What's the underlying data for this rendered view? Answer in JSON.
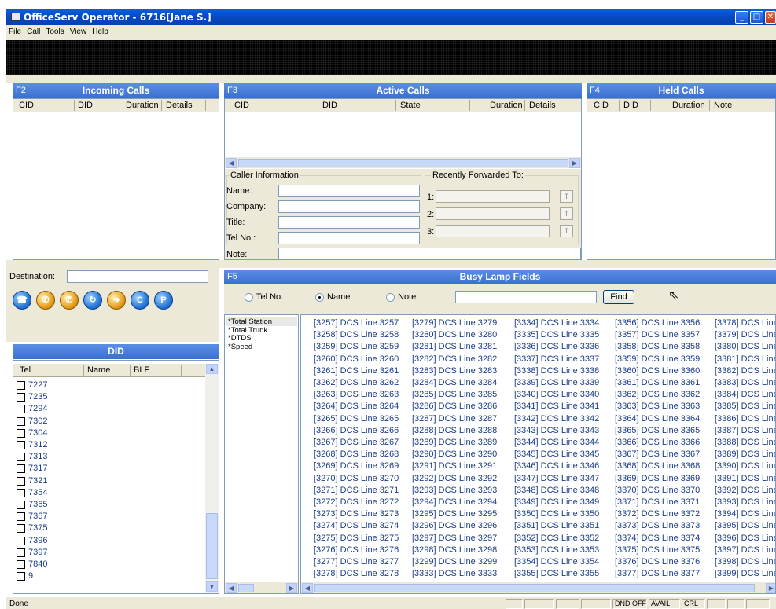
{
  "window": {
    "title": "OfficeServ Operator - 6716[Jane S.]"
  },
  "menu": [
    "File",
    "Call",
    "Tools",
    "View",
    "Help"
  ],
  "incoming": {
    "key": "F2",
    "title": "Incoming Calls",
    "columns": [
      "CID",
      "DID",
      "Duration",
      "Details"
    ]
  },
  "active": {
    "key": "F3",
    "title": "Active Calls",
    "columns": [
      "CID",
      "DID",
      "State",
      "Duration",
      "Details"
    ]
  },
  "held": {
    "key": "F4",
    "title": "Held Calls",
    "columns": [
      "CID",
      "DID",
      "Duration",
      "Note"
    ]
  },
  "caller_info": {
    "group_label": "Caller Information",
    "name_label": "Name:",
    "company_label": "Company:",
    "title_label": "Title:",
    "tel_label": "Tel No.:",
    "note_label": "Note:",
    "name": "",
    "company": "",
    "title": "",
    "tel": "",
    "note": ""
  },
  "forwarded": {
    "group_label": "Recently Forwarded To:",
    "slots": [
      "1:",
      "2:",
      "3:"
    ],
    "button": "T"
  },
  "destination": {
    "label": "Destination:",
    "value": ""
  },
  "toolbar_icons": [
    "dial-icon",
    "answer-icon",
    "hangup-icon",
    "transfer-icon",
    "forward-icon",
    "conference-icon",
    "park-icon"
  ],
  "did": {
    "title": "DID",
    "columns": [
      "Tel",
      "Name",
      "BLF"
    ],
    "rows": [
      "7227",
      "7235",
      "7294",
      "7302",
      "7304",
      "7312",
      "7313",
      "7317",
      "7321",
      "7354",
      "7365",
      "7367",
      "7375",
      "7396",
      "7397",
      "7840",
      "9"
    ]
  },
  "blf": {
    "key": "F5",
    "title": "Busy Lamp Fields",
    "search_options": [
      "Tel No.",
      "Name",
      "Note"
    ],
    "selected_option": "Name",
    "search_value": "",
    "find_label": "Find",
    "groups": [
      "*Total Station",
      "*Total Trunk",
      "*DTDS",
      "*Speed"
    ],
    "columns": [
      [
        "[3257] DCS Line 3257",
        "[3258] DCS Line 3258",
        "[3259] DCS Line 3259",
        "[3260] DCS Line 3260",
        "[3261] DCS Line 3261",
        "[3262] DCS Line 3262",
        "[3263] DCS Line 3263",
        "[3264] DCS Line 3264",
        "[3265] DCS Line 3265",
        "[3266] DCS Line 3266",
        "[3267] DCS Line 3267",
        "[3268] DCS Line 3268",
        "[3269] DCS Line 3269",
        "[3270] DCS Line 3270",
        "[3271] DCS Line 3271",
        "[3272] DCS Line 3272",
        "[3273] DCS Line 3273",
        "[3274] DCS Line 3274",
        "[3275] DCS Line 3275",
        "[3276] DCS Line 3276",
        "[3277] DCS Line 3277",
        "[3278] DCS Line 3278"
      ],
      [
        "[3279] DCS Line 3279",
        "[3280] DCS Line 3280",
        "[3281] DCS Line 3281",
        "[3282] DCS Line 3282",
        "[3283] DCS Line 3283",
        "[3284] DCS Line 3284",
        "[3285] DCS Line 3285",
        "[3286] DCS Line 3286",
        "[3287] DCS Line 3287",
        "[3288] DCS Line 3288",
        "[3289] DCS Line 3289",
        "[3290] DCS Line 3290",
        "[3291] DCS Line 3291",
        "[3292] DCS Line 3292",
        "[3293] DCS Line 3293",
        "[3294] DCS Line 3294",
        "[3295] DCS Line 3295",
        "[3296] DCS Line 3296",
        "[3297] DCS Line 3297",
        "[3298] DCS Line 3298",
        "[3299] DCS Line 3299",
        "[3333] DCS Line 3333"
      ],
      [
        "[3334] DCS Line 3334",
        "[3335] DCS Line 3335",
        "[3336] DCS Line 3336",
        "[3337] DCS Line 3337",
        "[3338] DCS Line 3338",
        "[3339] DCS Line 3339",
        "[3340] DCS Line 3340",
        "[3341] DCS Line 3341",
        "[3342] DCS Line 3342",
        "[3343] DCS Line 3343",
        "[3344] DCS Line 3344",
        "[3345] DCS Line 3345",
        "[3346] DCS Line 3346",
        "[3347] DCS Line 3347",
        "[3348] DCS Line 3348",
        "[3349] DCS Line 3349",
        "[3350] DCS Line 3350",
        "[3351] DCS Line 3351",
        "[3352] DCS Line 3352",
        "[3353] DCS Line 3353",
        "[3354] DCS Line 3354",
        "[3355] DCS Line 3355"
      ],
      [
        "[3356] DCS Line 3356",
        "[3357] DCS Line 3357",
        "[3358] DCS Line 3358",
        "[3359] DCS Line 3359",
        "[3360] DCS Line 3360",
        "[3361] DCS Line 3361",
        "[3362] DCS Line 3362",
        "[3363] DCS Line 3363",
        "[3364] DCS Line 3364",
        "[3365] DCS Line 3365",
        "[3366] DCS Line 3366",
        "[3367] DCS Line 3367",
        "[3368] DCS Line 3368",
        "[3369] DCS Line 3369",
        "[3370] DCS Line 3370",
        "[3371] DCS Line 3371",
        "[3372] DCS Line 3372",
        "[3373] DCS Line 3373",
        "[3374] DCS Line 3374",
        "[3375] DCS Line 3375",
        "[3376] DCS Line 3376",
        "[3377] DCS Line 3377"
      ],
      [
        "[3378] DCS Line",
        "[3379] DCS Line",
        "[3380] DCS Line",
        "[3381] DCS Line",
        "[3382] DCS Line",
        "[3383] DCS Line",
        "[3384] DCS Line",
        "[3385] DCS Line",
        "[3386] DCS Line",
        "[3387] DCS Line",
        "[3388] DCS Line",
        "[3389] DCS Line",
        "[3390] DCS Line",
        "[3391] DCS Line",
        "[3392] DCS Line",
        "[3393] DCS Line",
        "[3394] DCS Line",
        "[3395] DCS Line",
        "[3396] DCS Line",
        "[3397] DCS Line",
        "[3398] DCS Line",
        "[3399] DCS Line"
      ]
    ]
  },
  "status": {
    "text": "Done",
    "dnd": "DND OFF",
    "avail": "AVAIL",
    "crl": "CRL"
  },
  "colors": {
    "title_bar": "#0848c0",
    "panel_header": "#4a7fdc",
    "link_text": "#1a3c8a"
  }
}
